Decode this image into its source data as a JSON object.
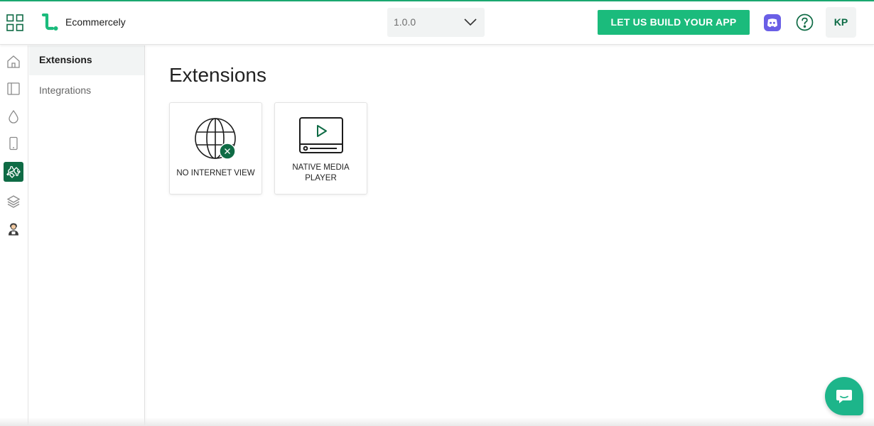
{
  "header": {
    "app_name": "Ecommercely",
    "version": "1.0.0",
    "cta_label": "LET US BUILD YOUR APP",
    "avatar_initials": "KP",
    "brand_color": "#1bbb7c",
    "icons": [
      "apps-grid-icon",
      "brand-logo-icon",
      "chevron-down-icon",
      "discord-icon",
      "help-icon"
    ]
  },
  "rail": {
    "items": [
      {
        "icon": "home-icon"
      },
      {
        "icon": "layout-icon"
      },
      {
        "icon": "drop-icon"
      },
      {
        "icon": "phone-icon"
      },
      {
        "icon": "puzzle-icon",
        "active": true
      },
      {
        "icon": "layers-icon"
      },
      {
        "icon": "support-agent-icon"
      }
    ],
    "active_color": "#0f6b45"
  },
  "subnav": {
    "items": [
      {
        "label": "Extensions",
        "active": true
      },
      {
        "label": "Integrations",
        "active": false
      }
    ]
  },
  "main": {
    "title": "Extensions",
    "cards": [
      {
        "label": "NO INTERNET VIEW",
        "icon": "globe-offline-icon"
      },
      {
        "label": "NATIVE MEDIA PLAYER",
        "icon": "video-player-icon"
      }
    ]
  },
  "chat": {
    "icon": "chat-bubble-icon",
    "color": "#1db58a"
  }
}
